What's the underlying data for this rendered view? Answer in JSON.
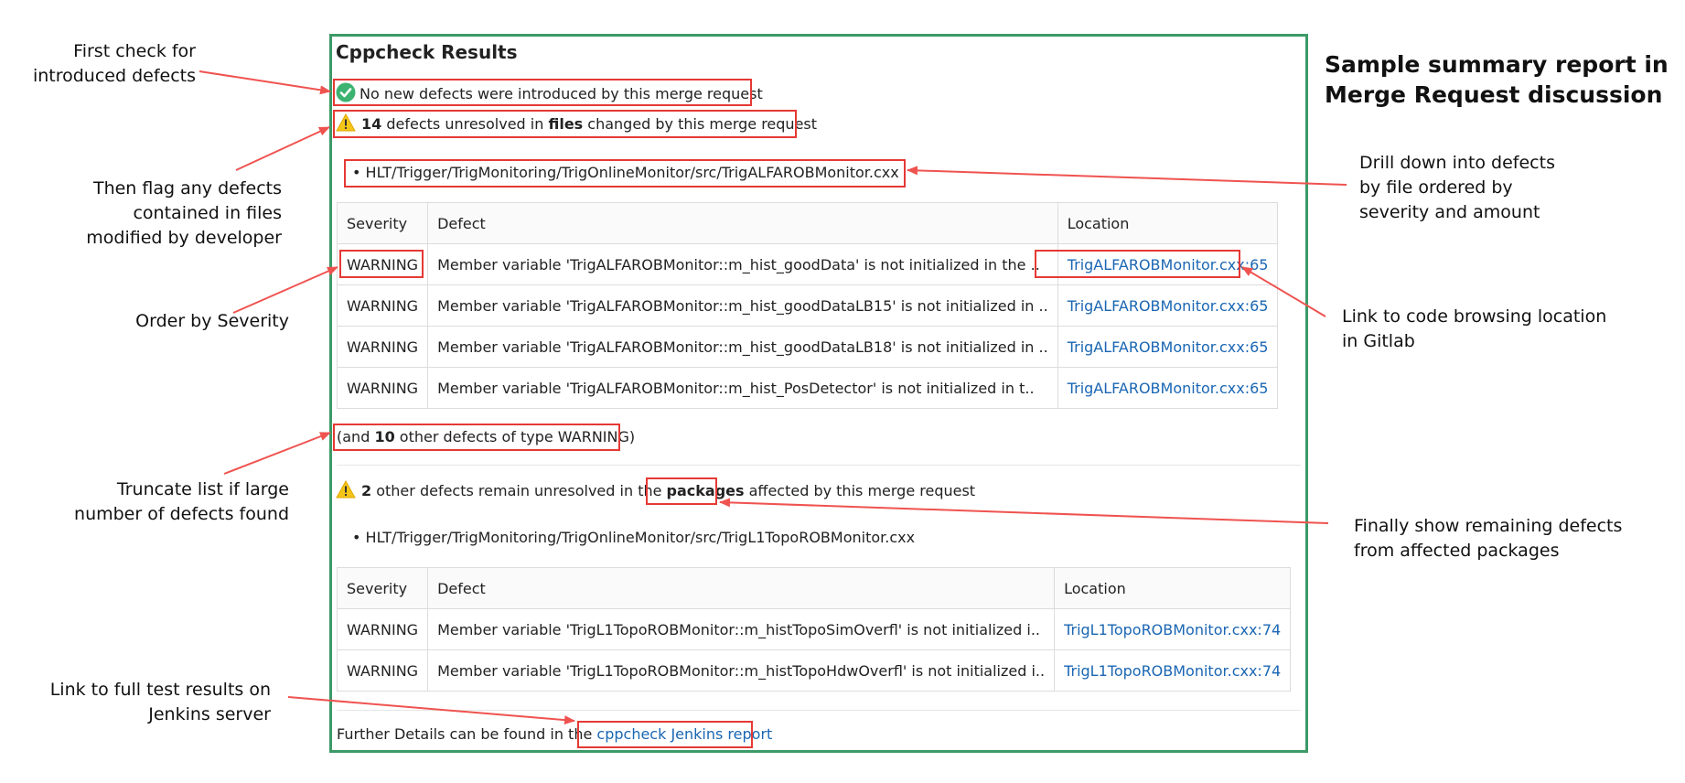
{
  "summary_title_line1": "Sample summary report in",
  "summary_title_line2": "Merge Request discussion",
  "annotations": {
    "first_check": [
      "First check for",
      "introduced defects"
    ],
    "flag_files": [
      "Then flag any defects",
      "contained in files",
      "modified by developer"
    ],
    "order_severity": [
      "Order by Severity"
    ],
    "truncate": [
      "Truncate list if large",
      "number of defects found"
    ],
    "link_jenkins": [
      "Link to full test results on",
      "Jenkins server"
    ],
    "drill_down": [
      "Drill down into defects",
      "by file ordered by",
      "severity and amount"
    ],
    "link_code": [
      "Link to code browsing location",
      "in Gitlab"
    ],
    "remaining": [
      "Finally show remaining defects",
      "from affected packages"
    ]
  },
  "report": {
    "title": "Cppcheck Results",
    "no_new": "No new defects were introduced by this merge request",
    "files_count": "14",
    "files_mid": " defects unresolved in ",
    "files_word": "files",
    "files_end": " changed by this merge request",
    "file1": "HLT/Trigger/TrigMonitoring/TrigOnlineMonitor/src/TrigALFAROBMonitor.cxx",
    "headers": [
      "Severity",
      "Defect",
      "Location"
    ],
    "rows1": [
      {
        "severity": "WARNING",
        "defect": "Member variable 'TrigALFAROBMonitor::m_hist_goodData' is not initialized in the ..",
        "location": "TrigALFAROBMonitor.cxx:65"
      },
      {
        "severity": "WARNING",
        "defect": "Member variable 'TrigALFAROBMonitor::m_hist_goodDataLB15' is not initialized in ..",
        "location": "TrigALFAROBMonitor.cxx:65"
      },
      {
        "severity": "WARNING",
        "defect": "Member variable 'TrigALFAROBMonitor::m_hist_goodDataLB18' is not initialized in ..",
        "location": "TrigALFAROBMonitor.cxx:65"
      },
      {
        "severity": "WARNING",
        "defect": "Member variable 'TrigALFAROBMonitor::m_hist_PosDetector' is not initialized in t..",
        "location": "TrigALFAROBMonitor.cxx:65"
      }
    ],
    "truncate_pre": "(and ",
    "truncate_count": "10",
    "truncate_post": " other defects of type WARNING)",
    "pkg_count": "2",
    "pkg_mid": " other defects remain unresolved in the ",
    "pkg_word": "packages",
    "pkg_end": " affected by this merge request",
    "file2": "HLT/Trigger/TrigMonitoring/TrigOnlineMonitor/src/TrigL1TopoROBMonitor.cxx",
    "rows2": [
      {
        "severity": "WARNING",
        "defect": "Member variable 'TrigL1TopoROBMonitor::m_histTopoSimOverfl' is not initialized i..",
        "location": "TrigL1TopoROBMonitor.cxx:74"
      },
      {
        "severity": "WARNING",
        "defect": "Member variable 'TrigL1TopoROBMonitor::m_histTopoHdwOverfl' is not initialized i..",
        "location": "TrigL1TopoROBMonitor.cxx:74"
      }
    ],
    "footer_pre": "Further Details can be found in the ",
    "footer_link": "cppcheck Jenkins report"
  },
  "colors": {
    "panel_border": "#3c9a68",
    "highlight_box": "#e53935",
    "arrow": "#ef5350",
    "link": "#1a66b3",
    "check": "#3cb371",
    "warning": "#f5c518"
  }
}
